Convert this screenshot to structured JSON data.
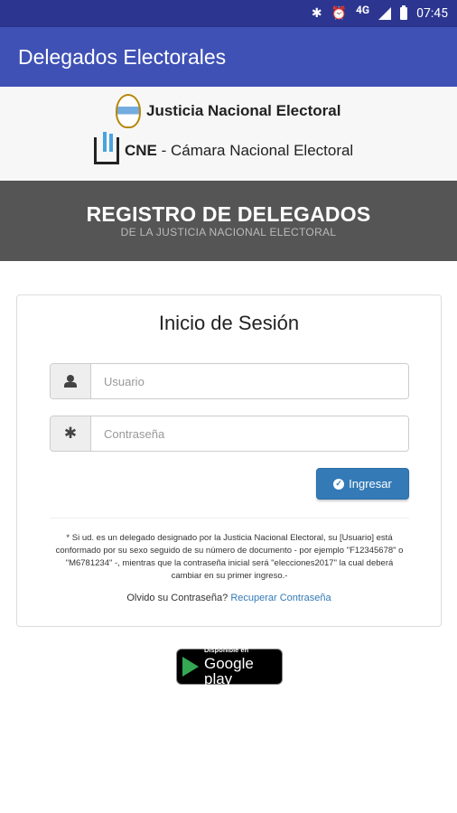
{
  "status_bar": {
    "icons": [
      "bluetooth-icon",
      "alarm-icon",
      "signal-icon",
      "battery-icon"
    ],
    "network": "4G",
    "time": "07:45"
  },
  "app_bar": {
    "title": "Delegados Electorales"
  },
  "header_logos": {
    "logo1_text": "Justicia Nacional Electoral",
    "logo2_bold": "CNE",
    "logo2_text": " - Cámara Nacional Electoral"
  },
  "banner": {
    "title": "REGISTRO DE DELEGADOS",
    "subtitle": "DE LA JUSTICIA NACIONAL ELECTORAL"
  },
  "login": {
    "heading": "Inicio de Sesión",
    "username_placeholder": "Usuario",
    "password_placeholder": "Contraseña",
    "submit_label": "Ingresar",
    "note": "* Si ud. es un delegado designado por la Justicia Nacional Electoral, su [Usuario] está conformado por su sexo seguido de su número de documento - por ejemplo \"F12345678\" o \"M6781234\" -, mientras que la contraseña inicial será \"elecciones2017\" la cual deberá cambiar en su primer ingreso.-",
    "forgot_prefix": "Olvido su Contraseña?",
    "forgot_link": "Recuperar Contraseña"
  },
  "store_badge": {
    "small": "Disponible en",
    "big": "Google play"
  },
  "colors": {
    "status_bar": "#2c3690",
    "app_bar": "#3f51b5",
    "banner": "#555555",
    "button": "#337ab7"
  }
}
